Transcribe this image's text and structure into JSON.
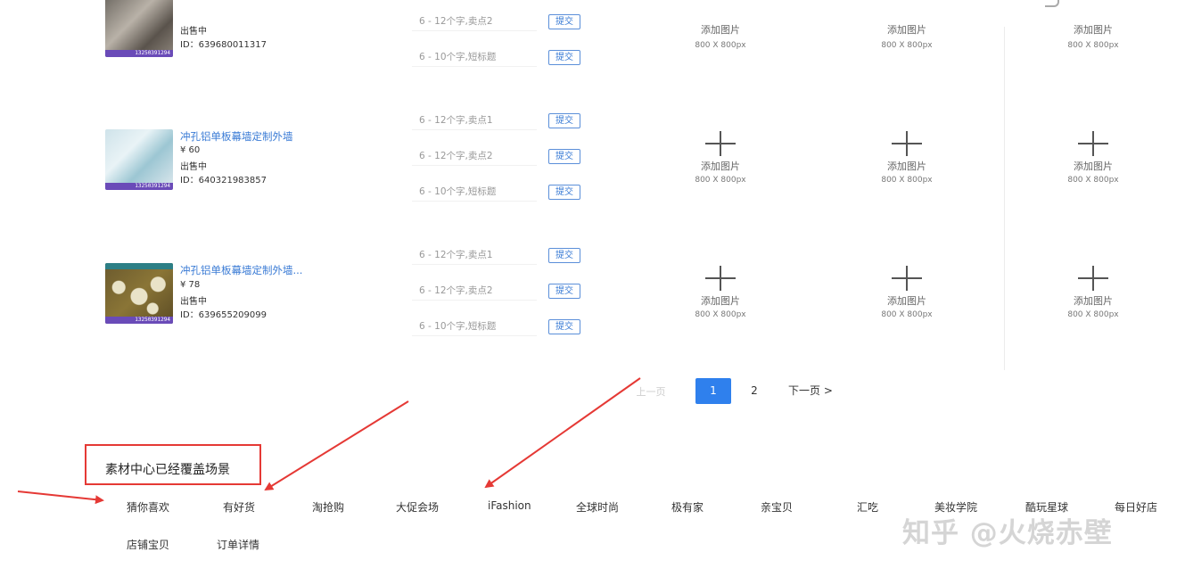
{
  "products": [
    {
      "title": "",
      "price": "",
      "status": "出售中",
      "id": "ID：639680011317",
      "watermark": "13250391294"
    },
    {
      "title": "冲孔铝单板幕墙定制外墙",
      "price": "¥ 60",
      "status": "出售中",
      "id": "ID：640321983857",
      "watermark": "13250391294"
    },
    {
      "title": "冲孔铝单板幕墙定制外墙...",
      "price": "¥ 78",
      "status": "出售中",
      "id": "ID：639655209099",
      "watermark": "13250391294"
    }
  ],
  "selling_points": {
    "rows": [
      [
        {
          "placeholder": "6 - 12个字,卖点2",
          "button": "提交"
        },
        {
          "placeholder": "6 - 10个字,短标题",
          "button": "提交"
        }
      ],
      [
        {
          "placeholder": "6 - 12个字,卖点1",
          "button": "提交"
        },
        {
          "placeholder": "6 - 12个字,卖点2",
          "button": "提交"
        },
        {
          "placeholder": "6 - 10个字,短标题",
          "button": "提交"
        }
      ],
      [
        {
          "placeholder": "6 - 12个字,卖点1",
          "button": "提交"
        },
        {
          "placeholder": "6 - 12个字,卖点2",
          "button": "提交"
        },
        {
          "placeholder": "6 - 10个字,短标题",
          "button": "提交"
        }
      ]
    ]
  },
  "upload": {
    "label": "添加图片",
    "size": "800 X 800px",
    "icon": "plus-icon"
  },
  "pagination": {
    "prev": "上一页",
    "current": "1",
    "next_page": "2",
    "next": "下一页 >"
  },
  "scenarios": {
    "title": "素材中心已经覆盖场景",
    "items": [
      "猜你喜欢",
      "有好货",
      "淘抢购",
      "大促会场",
      "iFashion",
      "全球时尚",
      "极有家",
      "亲宝贝",
      "汇吃",
      "美妆学院",
      "酷玩星球",
      "每日好店",
      "店铺宝贝",
      "订单详情"
    ]
  },
  "watermark": "知乎 @火烧赤壁",
  "colors": {
    "accent": "#2f80ed",
    "link": "#3a7bd5",
    "annotation": "#e53935"
  }
}
